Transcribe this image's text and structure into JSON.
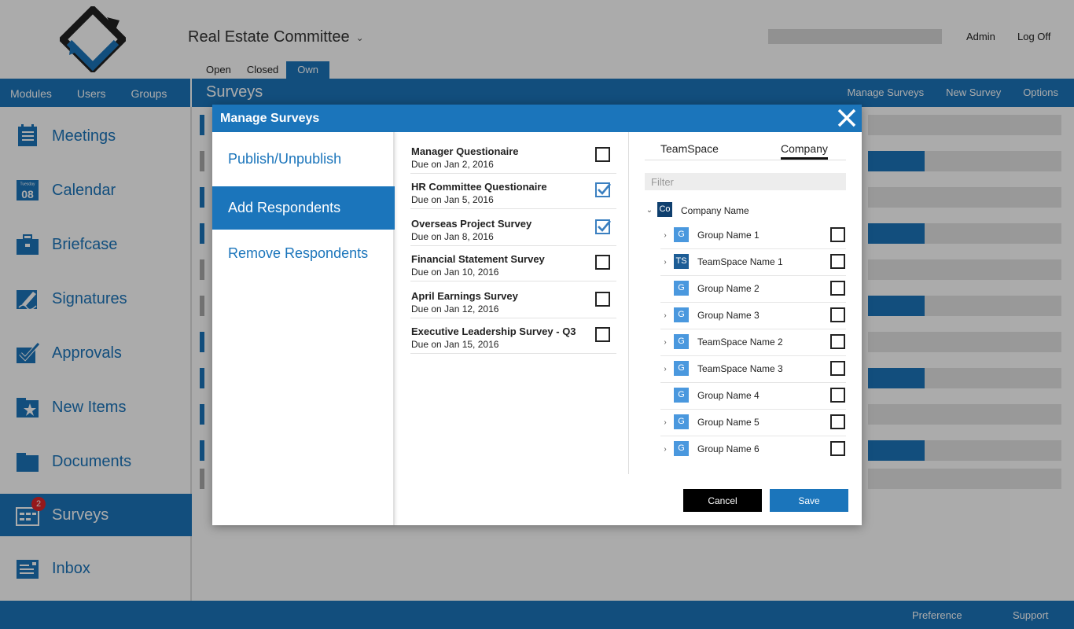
{
  "app": {
    "committee": "Real Estate Committee",
    "top_links": {
      "admin": "Admin",
      "logoff": "Log Off"
    },
    "filter_tabs": [
      "Open",
      "Closed",
      "Own"
    ],
    "nav": {
      "modules": "Modules",
      "users": "Users",
      "groups": "Groups"
    },
    "section_title": "Surveys",
    "right_nav": [
      "Manage Surveys",
      "New Survey",
      "Options"
    ],
    "sidebar": [
      {
        "label": "Meetings",
        "icon": "meetings-icon"
      },
      {
        "label": "Calendar",
        "icon": "calendar-icon",
        "icon_day": "Tuesday",
        "icon_date": "08"
      },
      {
        "label": "Briefcase",
        "icon": "briefcase-icon"
      },
      {
        "label": "Signatures",
        "icon": "signature-icon"
      },
      {
        "label": "Approvals",
        "icon": "approvals-icon"
      },
      {
        "label": "New Items",
        "icon": "new-items-icon"
      },
      {
        "label": "Documents",
        "icon": "documents-icon"
      },
      {
        "label": "Surveys",
        "icon": "surveys-icon",
        "badge": "2"
      },
      {
        "label": "Inbox",
        "icon": "inbox-icon"
      }
    ],
    "footer": {
      "preference": "Preference",
      "support": "Support"
    }
  },
  "modal": {
    "title": "Manage Surveys",
    "actions": [
      {
        "label": "Publish/Unpublish"
      },
      {
        "label": "Add Respondents",
        "active": true
      },
      {
        "label": "Remove Respondents"
      }
    ],
    "surveys": [
      {
        "name": "Manager Questionaire",
        "due": "Due on Jan 2, 2016",
        "checked": false
      },
      {
        "name": "HR Committee Questionaire",
        "due": "Due on Jan 5, 2016",
        "checked": true
      },
      {
        "name": "Overseas Project Survey",
        "due": "Due on Jan 8, 2016",
        "checked": true
      },
      {
        "name": "Financial Statement Survey",
        "due": "Due on Jan 10, 2016",
        "checked": false
      },
      {
        "name": "April Earnings Survey",
        "due": "Due on Jan 12, 2016",
        "checked": false
      },
      {
        "name": "Executive Leadership Survey - Q3",
        "due": "Due on Jan 15, 2016",
        "checked": false
      }
    ],
    "tabs": {
      "teamspace": "TeamSpace",
      "company": "Company"
    },
    "filter_placeholder": "Filter",
    "tree_root": {
      "abbr": "Co",
      "name": "Company Name"
    },
    "tree": [
      {
        "abbr": "G",
        "name": "Group Name 1",
        "expandable": true,
        "style": "light"
      },
      {
        "abbr": "TS",
        "name": "TeamSpace Name 1",
        "expandable": true,
        "style": "dark"
      },
      {
        "abbr": "G",
        "name": "Group Name 2",
        "expandable": false,
        "style": "light"
      },
      {
        "abbr": "G",
        "name": "Group Name 3",
        "expandable": true,
        "style": "light"
      },
      {
        "abbr": "G",
        "name": "TeamSpace Name 2",
        "expandable": true,
        "style": "light"
      },
      {
        "abbr": "G",
        "name": "TeamSpace Name 3",
        "expandable": true,
        "style": "light"
      },
      {
        "abbr": "G",
        "name": "Group Name 4",
        "expandable": false,
        "style": "light"
      },
      {
        "abbr": "G",
        "name": "Group Name 5",
        "expandable": true,
        "style": "light"
      },
      {
        "abbr": "G",
        "name": "Group Name 6",
        "expandable": true,
        "style": "light"
      }
    ],
    "cancel_label": "Cancel",
    "save_label": "Save"
  },
  "colors": {
    "primary": "#1b75bb",
    "check": "#3a7fc0",
    "badge": "#e0262b"
  }
}
